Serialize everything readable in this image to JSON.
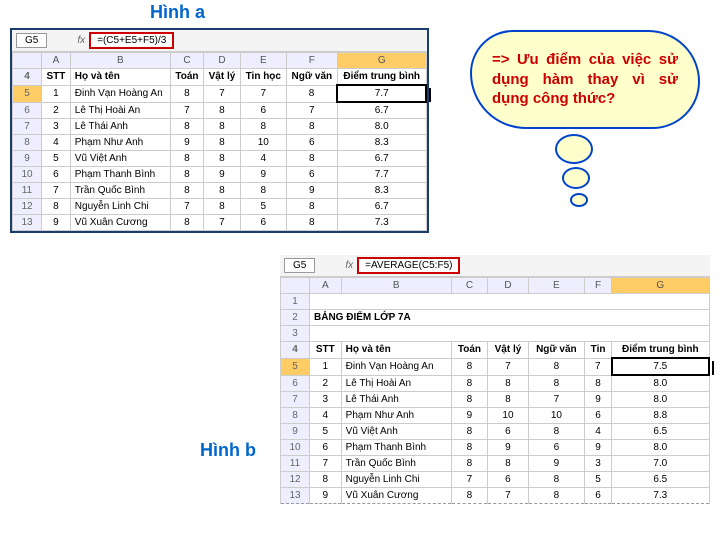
{
  "labels": {
    "a": "Hình a",
    "b": "Hình b"
  },
  "cloud": {
    "text": "=> Ưu điểm của việc sử dụng hàm thay vì sử dụng công thức?"
  },
  "panelA": {
    "cellref": "G5",
    "fx": "fx",
    "formula": "=(C5+E5+F5)/3",
    "cols": [
      "",
      "A",
      "B",
      "C",
      "D",
      "E",
      "F",
      "G"
    ],
    "headers": {
      "stt": "STT",
      "name": "Họ và tên",
      "c": "Toán",
      "d": "Vật lý",
      "e": "Tin học",
      "f": "Ngữ văn",
      "g": "Điểm trung bình"
    },
    "rows": [
      {
        "r": "5",
        "a": "1",
        "b": "Đinh Vạn Hoàng An",
        "c": "8",
        "d": "7",
        "e": "7",
        "f": "8",
        "g": "7.7"
      },
      {
        "r": "6",
        "a": "2",
        "b": "Lê Thị Hoài An",
        "c": "7",
        "d": "8",
        "e": "6",
        "f": "7",
        "g": "6.7"
      },
      {
        "r": "7",
        "a": "3",
        "b": "Lê Thái Anh",
        "c": "8",
        "d": "8",
        "e": "8",
        "f": "8",
        "g": "8.0"
      },
      {
        "r": "8",
        "a": "4",
        "b": "Phạm Như Anh",
        "c": "9",
        "d": "8",
        "e": "10",
        "f": "6",
        "g": "8.3"
      },
      {
        "r": "9",
        "a": "5",
        "b": "Vũ Việt Anh",
        "c": "8",
        "d": "8",
        "e": "4",
        "f": "8",
        "g": "6.7"
      },
      {
        "r": "10",
        "a": "6",
        "b": "Phạm Thanh Bình",
        "c": "8",
        "d": "9",
        "e": "9",
        "f": "6",
        "g": "7.7"
      },
      {
        "r": "11",
        "a": "7",
        "b": "Trần Quốc Bình",
        "c": "8",
        "d": "8",
        "e": "8",
        "f": "9",
        "g": "8.3"
      },
      {
        "r": "12",
        "a": "8",
        "b": "Nguyễn Linh Chi",
        "c": "7",
        "d": "8",
        "e": "5",
        "f": "8",
        "g": "6.7"
      },
      {
        "r": "13",
        "a": "9",
        "b": "Vũ Xuân Cương",
        "c": "8",
        "d": "7",
        "e": "6",
        "f": "8",
        "g": "7.3"
      }
    ]
  },
  "panelB": {
    "cellref": "G5",
    "fx": "fx",
    "formula": "=AVERAGE(C5:F5)",
    "cols": [
      "",
      "A",
      "B",
      "C",
      "D",
      "E",
      "F",
      "G"
    ],
    "title": "BẢNG ĐIỂM LỚP 7A",
    "headers": {
      "stt": "STT",
      "name": "Họ và tên",
      "c": "Toán",
      "d": "Vật lý",
      "e": "Ngữ văn",
      "f": "Tin",
      "g": "Điểm trung bình"
    },
    "rows": [
      {
        "r": "5",
        "a": "1",
        "b": "Đinh Vạn Hoàng An",
        "c": "8",
        "d": "7",
        "e": "8",
        "f": "7",
        "g": "7.5"
      },
      {
        "r": "6",
        "a": "2",
        "b": "Lê Thị Hoài An",
        "c": "8",
        "d": "8",
        "e": "8",
        "f": "8",
        "g": "8.0"
      },
      {
        "r": "7",
        "a": "3",
        "b": "Lê Thái Anh",
        "c": "8",
        "d": "8",
        "e": "7",
        "f": "9",
        "g": "8.0"
      },
      {
        "r": "8",
        "a": "4",
        "b": "Phạm Như Anh",
        "c": "9",
        "d": "10",
        "e": "10",
        "f": "6",
        "g": "8.8"
      },
      {
        "r": "9",
        "a": "5",
        "b": "Vũ Việt Anh",
        "c": "8",
        "d": "6",
        "e": "8",
        "f": "4",
        "g": "6.5"
      },
      {
        "r": "10",
        "a": "6",
        "b": "Phạm Thanh Bình",
        "c": "8",
        "d": "9",
        "e": "6",
        "f": "9",
        "g": "8.0"
      },
      {
        "r": "11",
        "a": "7",
        "b": "Trần Quốc Bình",
        "c": "8",
        "d": "8",
        "e": "9",
        "f": "3",
        "g": "7.0"
      },
      {
        "r": "12",
        "a": "8",
        "b": "Nguyễn Linh Chi",
        "c": "7",
        "d": "6",
        "e": "8",
        "f": "5",
        "g": "6.5"
      },
      {
        "r": "13",
        "a": "9",
        "b": "Vũ Xuân Cương",
        "c": "8",
        "d": "7",
        "e": "8",
        "f": "6",
        "g": "7.3"
      }
    ]
  }
}
